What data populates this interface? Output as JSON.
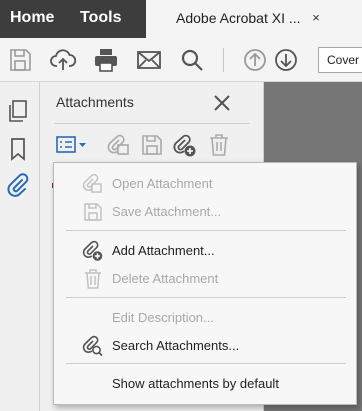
{
  "tabbar": {
    "home_label": "Home",
    "tools_label": "Tools",
    "doc_tab_label": "Adobe Acrobat XI ...",
    "doc_tab_close": "×"
  },
  "toolbar": {
    "page_field_value": "Cover"
  },
  "panel": {
    "title": "Attachments"
  },
  "menu": {
    "items": [
      {
        "label": "Open Attachment",
        "enabled": false,
        "icon": "open-attachment-icon"
      },
      {
        "label": "Save Attachment...",
        "enabled": false,
        "icon": "save-attachment-icon"
      },
      {
        "label": "Add Attachment...",
        "enabled": true,
        "icon": "add-attachment-icon"
      },
      {
        "label": "Delete Attachment",
        "enabled": false,
        "icon": "delete-attachment-icon"
      },
      {
        "label": "Edit Description...",
        "enabled": false,
        "icon": ""
      },
      {
        "label": "Search Attachments...",
        "enabled": true,
        "icon": "search-attachments-icon"
      },
      {
        "label": "Show attachments by default",
        "enabled": true,
        "icon": ""
      }
    ]
  },
  "colors": {
    "tabbar_bg": "#3d3d3d",
    "accent_blue": "#2d6ab3",
    "icon_gray": "#555555",
    "disabled_gray": "#a8a8a8"
  }
}
